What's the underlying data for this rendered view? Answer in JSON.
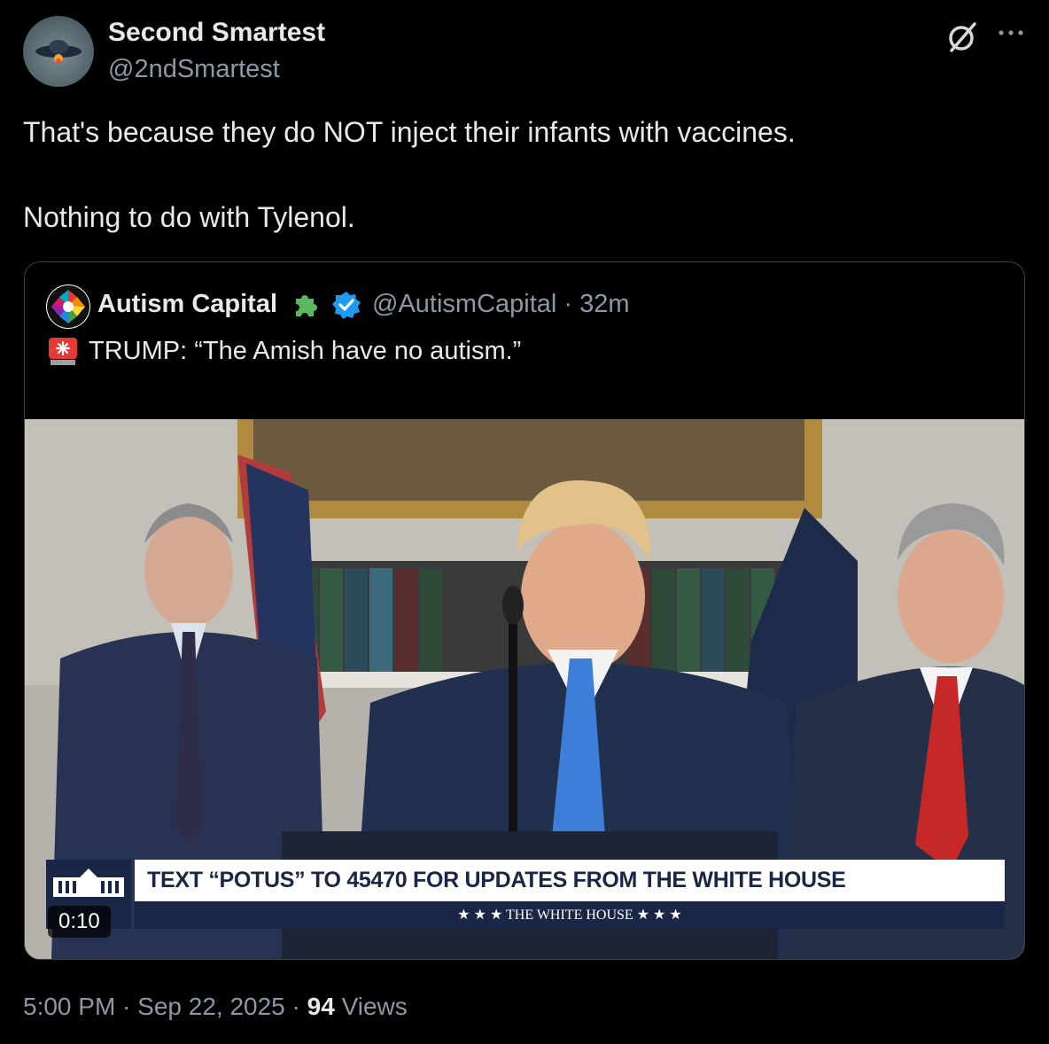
{
  "author": {
    "name": "Second Smartest",
    "handle": "@2ndSmartest"
  },
  "tweet": {
    "line1": "That's because they do NOT inject their infants with vaccines.",
    "line2": "Nothing to do with Tylenol."
  },
  "quote": {
    "name": "Autism Capital",
    "handle": "@AutismCapital · 32m",
    "text": "TRUMP: “The Amish have no autism.”",
    "video": {
      "time": "0:10",
      "chyron_main": "TEXT “POTUS” TO 45470 FOR UPDATES FROM THE WHITE HOUSE",
      "chyron_sub": "★ ★ ★   THE WHITE HOUSE   ★ ★ ★"
    }
  },
  "footer": {
    "time": "5:00 PM · Sep 22, 2025 · ",
    "views_count": "94",
    "views_label": " Views"
  },
  "icons": {
    "grok": "grok-icon",
    "more": "more-icon",
    "verified": "verified-badge-icon",
    "puzzle": "puzzle-piece-icon",
    "siren": "siren-icon"
  },
  "colors": {
    "accent": "#1d9bf0",
    "text": "#e7e9ea",
    "muted": "#8b98a5",
    "border": "#3b4146"
  }
}
